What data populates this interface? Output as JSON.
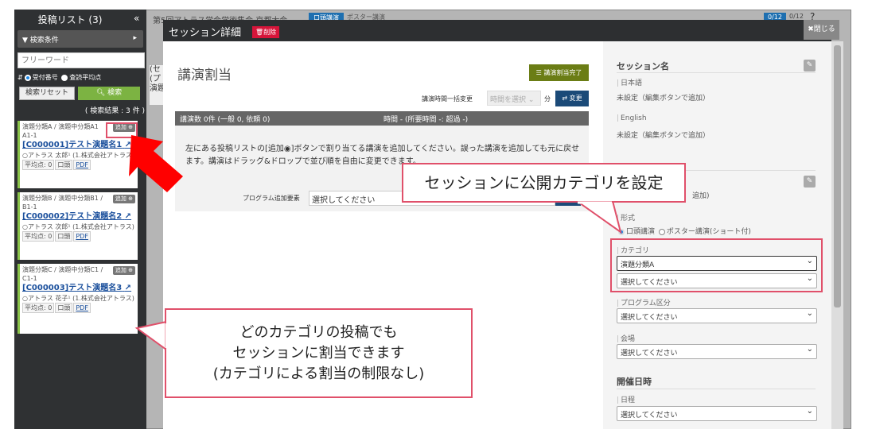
{
  "background": {
    "title": "第5回アトラス学会学術集会 京都大会",
    "tab_oral": "口頭講演",
    "tab_poster": "ポスター講演",
    "count1": "0/12",
    "count2": "0/12",
    "left_partial": "(セ (プ 演題"
  },
  "sidebar": {
    "title": "投稿リスト (3)",
    "collapse": "«",
    "filter": "検索条件",
    "search_placeholder": "フリーワード",
    "sort_opt1": "受付番号",
    "sort_opt2": "査読平均点",
    "reset": "検索リセット",
    "search": "検索",
    "result_count": "( 検索結果 : 3 件 )",
    "cards": [
      {
        "category": "演題分類A / 演題中分類A1",
        "sub": "A1-1",
        "title": "[C000001]テスト演題名1",
        "author": "○アトラス 太郎¹ (1.株式会社アトラス)",
        "score": "平均点: 0",
        "type": "口頭",
        "pdf": "PDF",
        "add": "追加"
      },
      {
        "category": "演題分類B / 演題中分類B1 /",
        "sub": "B1-1",
        "title": "[C000002]テスト演題名2",
        "author": "○アトラス 次郎¹ (1.株式会社アトラス)",
        "score": "平均点: 0",
        "type": "口頭",
        "pdf": "PDF",
        "add": "追加"
      },
      {
        "category": "演題分類C / 演題中分類C1 /",
        "sub": "C1-1",
        "title": "[C000003]テスト演題名3",
        "author": "○アトラス 花子¹ (1.株式会社アトラス)",
        "score": "平均点: 0",
        "type": "口頭",
        "pdf": "PDF",
        "add": "追加"
      }
    ]
  },
  "modal": {
    "title": "セッション詳細",
    "delete": "削除",
    "close": "閉じる",
    "assign_heading": "講演割当",
    "done": "講演割当完了",
    "bulk_label": "講演時間一括変更",
    "bulk_placeholder": "時間を選択",
    "minutes": "分",
    "change": "変更",
    "bar_left": "講演数 0件 (一般 0, 依頼 0)",
    "bar_right": "時間 - (所要時間 -: 超過 -)",
    "drop_text": "左にある投稿リストの[追加◉]ボタンで割り当てる講演を追加してください。誤った講演を追加しても元に戻せます。講演はドラッグ&ドロップで並び順を自由に変更できます。",
    "prog_label": "プログラム追加要素",
    "prog_placeholder": "選択してください"
  },
  "right": {
    "session_name": "セッション名",
    "ja": "日本語",
    "ja_val": "未設定（編集ボタンで追加）",
    "en": "English",
    "en_val": "未設定（編集ボタンで追加）",
    "sec2_val": "追加)",
    "format": "形式",
    "format_opt1": "口頭講演",
    "format_opt2": "ポスター講演(ショート付)",
    "category": "カテゴリ",
    "category_val": "演題分類A",
    "category_sub": "選択してください",
    "program": "プログラム区分",
    "program_val": "選択してください",
    "venue": "会場",
    "venue_val": "選択してください",
    "datetime": "開催日時",
    "date": "日程",
    "date_val": "選択してください"
  },
  "callouts": {
    "top": "セッションに公開カテゴリを設定",
    "bottom": [
      "どのカテゴリの投稿でも",
      "セッションに割当できます",
      "(カテゴリによる割当の制限なし)"
    ]
  },
  "colors": {
    "accent_red": "#e0506a",
    "delete": "#d6153a",
    "done": "#6b7d15",
    "change": "#1b4a78",
    "search": "#7cb342"
  }
}
